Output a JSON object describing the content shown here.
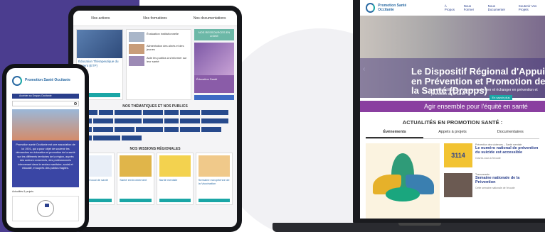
{
  "tablet": {
    "nav": [
      "Nos actions",
      "Nos formations",
      "Nos documentations"
    ],
    "hero_text": "Éducation Thérapeutique du Patient (ETP)",
    "list": [
      "Évaluation institutionnelle",
      "Alimentation des aînés et des jeunes",
      "Aide les publics à s'informer sur leur santé"
    ],
    "side_green": "NOS RESSOURCES EN LIGNE",
    "side_purple": "Éducation Santé",
    "themes_title": "NOS THÉMATIQUES ET NOS PUBLICS",
    "missions_title": "NOS MISSIONS RÉGIONALES",
    "missions": [
      "Contrat local de santé",
      "Santé environnement",
      "Santé mentale",
      "Semaine européenne de la Vaccination"
    ]
  },
  "phone": {
    "logo": "Promotion Santé Occitanie",
    "bar": "Accéder au Drapps Occitanie",
    "intro": "Promotion santé Occitanie est une association de loi 1901, qui a pour objet de soutenir les démarches en éducation et promotion de la santé sur les différents territoires de la région, auprès des acteurs concernés, des professionnels intervenant dans le secteur sanitaire, social et éducatif, et auprès des publics fragiles.",
    "label": "Actualités & projets"
  },
  "laptop": {
    "logo": "Promotion Santé Occitanie",
    "nav": [
      "À Propos",
      "Nous Former",
      "Nous Documenter",
      "Soutenir Vos Projets"
    ],
    "hero_title": "Le Dispositif Régional d'Appui en Prévention et Promotion de la Santé (Drapps)",
    "hero_sub": "un dispositif pour s'informer, se former et échanger en prévention et promotion de la santé",
    "hero_btn": "En savoir plus",
    "band": "Agir ensemble pour l'équité en santé",
    "actu_title": "ACTUALITÉS EN PROMOTION SANTÉ :",
    "tabs": [
      "Événements",
      "Appels à projets",
      "Documentaires"
    ],
    "items": [
      {
        "tag": "Prévention des violences – Santé mentale",
        "title": "Le numéro national de prévention du suicide est accessible",
        "text": "Ouvrez-vous à l'écoute"
      },
      {
        "tag": "Transversale",
        "title": "Semaine nationale de la Prévention",
        "text": "Cette semaine nationale de l'écoute"
      }
    ],
    "sticker": "3114"
  }
}
